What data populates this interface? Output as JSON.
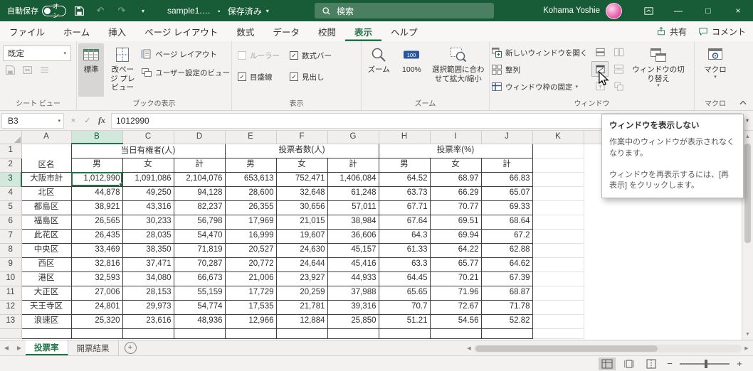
{
  "colors": {
    "accent": "#217346",
    "titlebar_green": "#185c37",
    "selection_header": "#d2e8dc"
  },
  "titlebar": {
    "autosave_label": "自動保存",
    "autosave_state": "オン",
    "filename": "sample1.…",
    "separator": "・",
    "saved_status": "保存済み",
    "search_placeholder": "検索",
    "user_name": "Kohama Yoshie"
  },
  "ribbon_tabs": [
    {
      "label": "ファイル",
      "active": false
    },
    {
      "label": "ホーム",
      "active": false
    },
    {
      "label": "挿入",
      "active": false
    },
    {
      "label": "ページ レイアウト",
      "active": false
    },
    {
      "label": "数式",
      "active": false
    },
    {
      "label": "データ",
      "active": false
    },
    {
      "label": "校閲",
      "active": false
    },
    {
      "label": "表示",
      "active": true
    },
    {
      "label": "ヘルプ",
      "active": false
    }
  ],
  "top_actions": {
    "share": "共有",
    "comments": "コメント"
  },
  "ribbon": {
    "sheet_view": {
      "group_label": "シート ビュー",
      "view_selector": "既定"
    },
    "workbook_views": {
      "group_label": "ブックの表示",
      "normal": "標準",
      "page_break_preview": "改ページ プレビュー",
      "page_layout": "ページ レイアウト",
      "custom_views": "ユーザー設定のビュー"
    },
    "show": {
      "group_label": "表示",
      "ruler": "ルーラー",
      "formula_bar": "数式バー",
      "gridlines": "目盛線",
      "headings": "見出し"
    },
    "zoom": {
      "group_label": "ズーム",
      "zoom": "ズーム",
      "hundred_percent": "100%",
      "zoom_to_selection": "選択範囲に合わせて拡大/縮小"
    },
    "window": {
      "group_label": "ウィンドウ",
      "new_window": "新しいウィンドウを開く",
      "arrange_all": "整列",
      "freeze_panes": "ウィンドウ枠の固定",
      "switch_windows": "ウィンドウの切り替え"
    },
    "macros": {
      "group_label": "マクロ",
      "macro": "マクロ"
    }
  },
  "formula_bar": {
    "name_box": "B3",
    "fx_label": "fx",
    "value": "1012990"
  },
  "tooltip": {
    "title": "ウィンドウを表示しない",
    "body1": "作業中のウィンドウが表示されなくなります。",
    "body2": "ウィンドウを再表示するには、[再表示] をクリックします。"
  },
  "sheet": {
    "column_letters": [
      "A",
      "B",
      "C",
      "D",
      "E",
      "F",
      "G",
      "H",
      "I",
      "J",
      "K"
    ],
    "header_row_numbers": [
      1,
      2
    ],
    "selected_cell": "B3",
    "selected_column": "B",
    "selected_row": 3,
    "header_row1": {
      "district": "区名",
      "eligible": "当日有権者(人)",
      "voters": "投票者数(人)",
      "turnout": "投票率(%)"
    },
    "header_row2": [
      "男",
      "女",
      "計",
      "男",
      "女",
      "計",
      "男",
      "女",
      "計"
    ],
    "data_rows": [
      {
        "row": 3,
        "name": "大阪市計",
        "values": [
          "1,012,990",
          "1,091,086",
          "2,104,076",
          "653,613",
          "752,471",
          "1,406,084",
          "64.52",
          "68.97",
          "66.83"
        ]
      },
      {
        "row": 4,
        "name": "北区",
        "values": [
          "44,878",
          "49,250",
          "94,128",
          "28,600",
          "32,648",
          "61,248",
          "63.73",
          "66.29",
          "65.07"
        ]
      },
      {
        "row": 5,
        "name": "都島区",
        "values": [
          "38,921",
          "43,316",
          "82,237",
          "26,355",
          "30,656",
          "57,011",
          "67.71",
          "70.77",
          "69.33"
        ]
      },
      {
        "row": 6,
        "name": "福島区",
        "values": [
          "26,565",
          "30,233",
          "56,798",
          "17,969",
          "21,015",
          "38,984",
          "67.64",
          "69.51",
          "68.64"
        ]
      },
      {
        "row": 7,
        "name": "此花区",
        "values": [
          "26,435",
          "28,035",
          "54,470",
          "16,999",
          "19,607",
          "36,606",
          "64.3",
          "69.94",
          "67.2"
        ]
      },
      {
        "row": 8,
        "name": "中央区",
        "values": [
          "33,469",
          "38,350",
          "71,819",
          "20,527",
          "24,630",
          "45,157",
          "61.33",
          "64.22",
          "62.88"
        ]
      },
      {
        "row": 9,
        "name": "西区",
        "values": [
          "32,816",
          "37,471",
          "70,287",
          "20,772",
          "24,644",
          "45,416",
          "63.3",
          "65.77",
          "64.62"
        ]
      },
      {
        "row": 10,
        "name": "港区",
        "values": [
          "32,593",
          "34,080",
          "66,673",
          "21,006",
          "23,927",
          "44,933",
          "64.45",
          "70.21",
          "67.39"
        ]
      },
      {
        "row": 11,
        "name": "大正区",
        "values": [
          "27,006",
          "28,153",
          "55,159",
          "17,729",
          "20,259",
          "37,988",
          "65.65",
          "71.96",
          "68.87"
        ]
      },
      {
        "row": 12,
        "name": "天王寺区",
        "values": [
          "24,801",
          "29,973",
          "54,774",
          "17,535",
          "21,781",
          "39,316",
          "70.7",
          "72.67",
          "71.78"
        ]
      },
      {
        "row": 13,
        "name": "浪速区",
        "values": [
          "25,320",
          "23,616",
          "48,936",
          "12,966",
          "12,884",
          "25,850",
          "51.21",
          "54.56",
          "52.82"
        ]
      }
    ]
  },
  "sheet_tabs": [
    {
      "label": "投票率",
      "active": true
    },
    {
      "label": "開票結果",
      "active": false
    }
  ],
  "icons": {
    "minimize": "—",
    "maximize": "□",
    "close": "×",
    "dropdown": "▾",
    "undo": "↶",
    "redo": "↷",
    "check": "✓",
    "cancel": "×",
    "left": "◀",
    "right": "▶",
    "up": "▲",
    "down": "▼",
    "plus": "+",
    "minus": "−",
    "add": "+"
  }
}
